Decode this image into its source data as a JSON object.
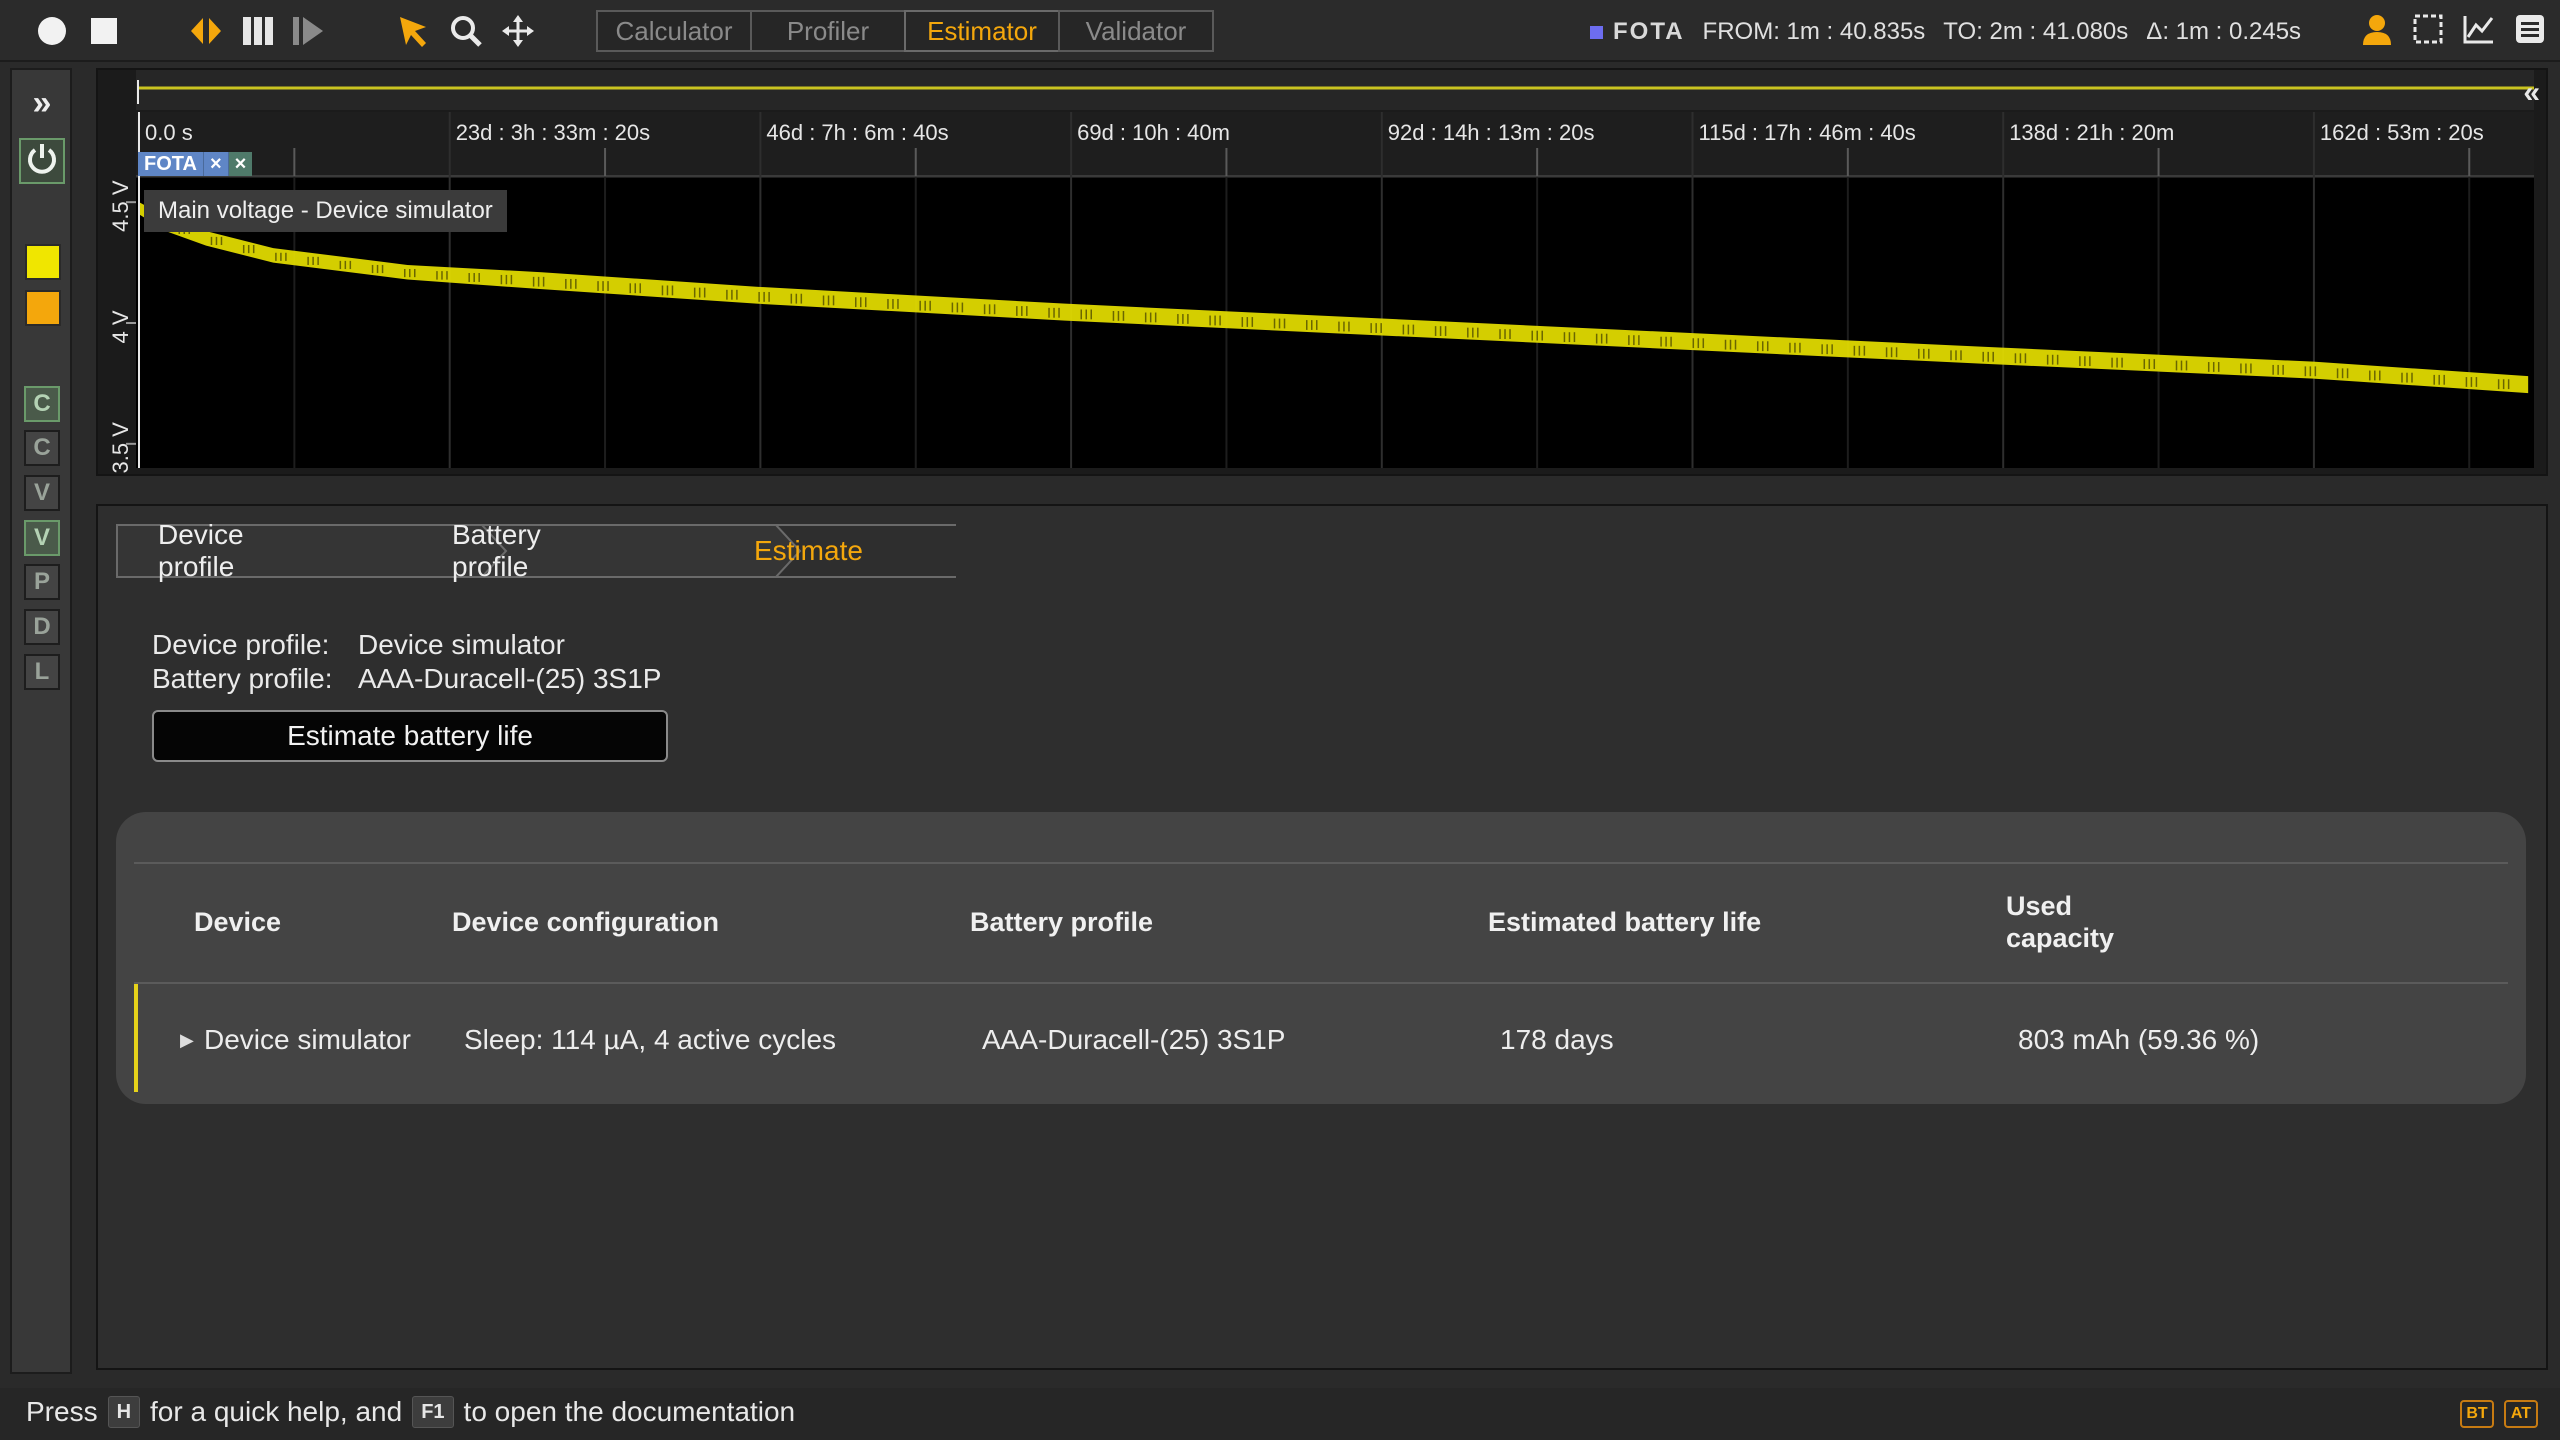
{
  "toolbar": {
    "icons": [
      "record-icon",
      "stop-icon",
      "trigger-icon",
      "pause-icon",
      "step-icon",
      "pointer-icon",
      "zoom-icon",
      "pan-icon"
    ],
    "tabs": [
      {
        "label": "Calculator",
        "active": false
      },
      {
        "label": "Profiler",
        "active": false
      },
      {
        "label": "Estimator",
        "active": true
      },
      {
        "label": "Validator",
        "active": false
      }
    ],
    "marker_name": "FOTA",
    "from": "FROM: 1m : 40.835s",
    "to": "TO: 2m : 41.080s",
    "delta": "Δ: 1m : 0.245s",
    "accent_color": "#f4a70c",
    "marker_color": "#6d6df0"
  },
  "sidebar": {
    "expand_glyph": "»",
    "colors": [
      "#f0e600",
      "#f4a70c"
    ],
    "letters": [
      {
        "label": "C",
        "on": true
      },
      {
        "label": "C",
        "on": false
      },
      {
        "label": "V",
        "on": false
      },
      {
        "label": "V",
        "on": true
      },
      {
        "label": "P",
        "on": false
      },
      {
        "label": "D",
        "on": false
      },
      {
        "label": "L",
        "on": false
      }
    ]
  },
  "chart": {
    "collapse_glyph": "«",
    "tooltip": "Main voltage - Device simulator",
    "marker_tag": "FOTA",
    "marker_close": "×",
    "series_color": "#e6e000"
  },
  "chart_data": {
    "type": "line",
    "title": "",
    "x_ticks": [
      "0.0 s",
      "23d : 3h : 33m : 20s",
      "46d : 7h : 6m : 40s",
      "69d : 10h : 40m",
      "92d : 14h : 13m : 20s",
      "115d : 17h : 46m : 40s",
      "138d : 21h : 20m",
      "162d : 53m : 20s"
    ],
    "y_ticks": [
      "4.5 V",
      "4 V",
      "3.5 V"
    ],
    "ylim": [
      3.4,
      4.6
    ],
    "series": [
      {
        "x_days": [
          0,
          2,
          5,
          10,
          20,
          30,
          46,
          69,
          92,
          115,
          138,
          162,
          178
        ],
        "upper": [
          4.5,
          4.44,
          4.38,
          4.31,
          4.24,
          4.21,
          4.15,
          4.08,
          4.02,
          3.96,
          3.9,
          3.84,
          3.78
        ],
        "lower": [
          4.45,
          4.38,
          4.32,
          4.25,
          4.18,
          4.14,
          4.08,
          4.01,
          3.95,
          3.89,
          3.83,
          3.77,
          3.71
        ]
      }
    ]
  },
  "estimator": {
    "steps": [
      {
        "label": "Device profile",
        "active": false
      },
      {
        "label": "Battery profile",
        "active": false
      },
      {
        "label": "Estimate",
        "active": true
      }
    ],
    "device_profile_label": "Device profile:",
    "device_profile_value": "Device simulator",
    "battery_profile_label": "Battery profile:",
    "battery_profile_value": "AAA-Duracell-(25) 3S1P",
    "estimate_button": "Estimate battery life",
    "table": {
      "headers": [
        "Device",
        "Device configuration",
        "Battery profile",
        "Estimated battery life",
        "Used capacity"
      ],
      "row": [
        "Device simulator",
        "Sleep: 114 µA, 4 active cycles",
        "AAA-Duracell-(25) 3S1P",
        "178 days",
        "803 mAh (59.36 %)"
      ]
    }
  },
  "status": {
    "press": "Press",
    "key_h": "H",
    "mid": "for a quick help, and",
    "key_f1": "F1",
    "end": "to open the documentation",
    "badges": [
      "BT",
      "AT"
    ]
  }
}
